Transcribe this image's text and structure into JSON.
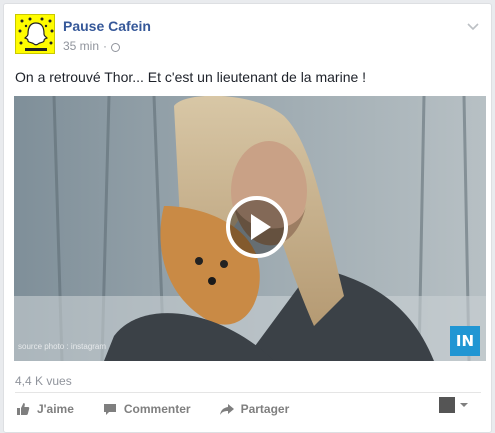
{
  "post": {
    "page_name": "Pause Cafein",
    "time": "35 min",
    "separator": "·",
    "text": "On a retrouvé Thor... Et c'est un lieutenant de la marine !",
    "views": "4,4 K vues",
    "media": {
      "logo_text": "IN",
      "watermark": "source photo : instagram"
    },
    "avatar_caption": "pausecafein"
  },
  "actions": [
    {
      "label": "J'aime",
      "icon": "thumbs-up-icon"
    },
    {
      "label": "Commenter",
      "icon": "comment-icon"
    },
    {
      "label": "Partager",
      "icon": "share-arrow-icon"
    }
  ],
  "colors": {
    "link": "#365899",
    "snap_yellow": "#fffc00",
    "muted": "#90949c",
    "logo_blue": "#2196d3"
  }
}
